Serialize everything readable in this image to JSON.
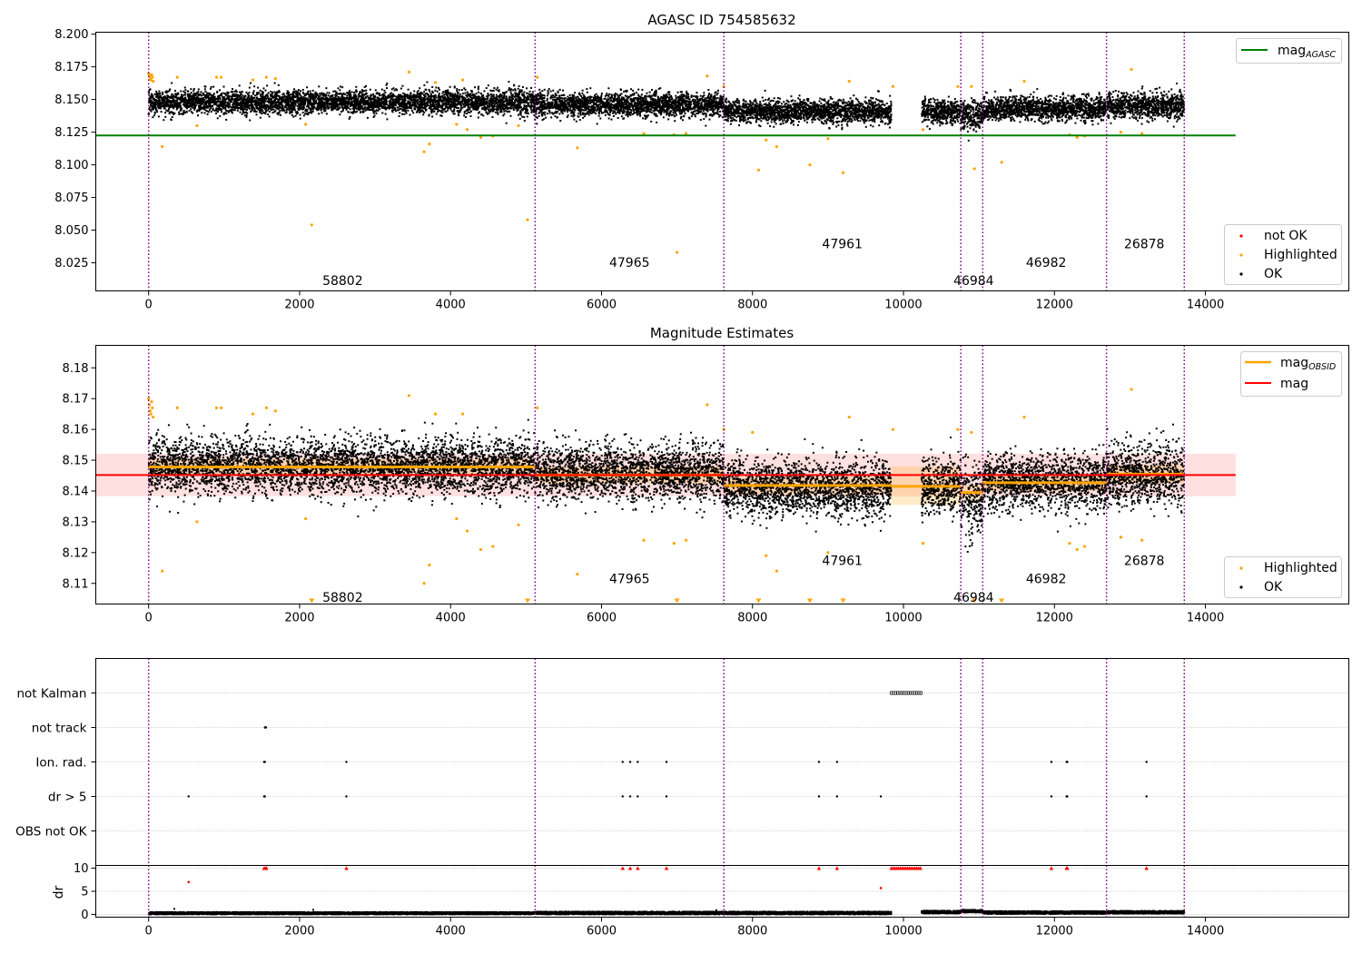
{
  "figure": {
    "background": "#ffffff"
  },
  "obsids": [
    "58802",
    "47965",
    "47961",
    "46984",
    "46982",
    "26878"
  ],
  "obsid_label_pos": [
    {
      "x": 2570,
      "panel1_y": 8.0115,
      "panel2_y": 8.1055
    },
    {
      "x": 6370,
      "panel1_y": 8.0255,
      "panel2_y": 8.1115
    },
    {
      "x": 9190,
      "panel1_y": 8.0395,
      "panel2_y": 8.1175
    },
    {
      "x": 10930,
      "panel1_y": 8.0115,
      "panel2_y": 8.1055
    },
    {
      "x": 11890,
      "panel1_y": 8.0255,
      "panel2_y": 8.1115
    },
    {
      "x": 13190,
      "panel1_y": 8.0395,
      "panel2_y": 8.1175
    }
  ],
  "boundaries": [
    0,
    5120,
    7620,
    10760,
    11050,
    12690,
    13720
  ],
  "gap": [
    9840,
    10240
  ],
  "colors": {
    "ok": "#000000",
    "highlighted": "#ffa500",
    "not_ok": "#ff0000",
    "agasc_line": "#008000",
    "mag_line": "#ff0000",
    "obsid_line": "#ffa500",
    "boundary": "#800080",
    "grid": "#b0b0b0"
  },
  "chart_data": [
    {
      "type": "scatter",
      "title": "AGASC ID 754585632",
      "xlim": [
        -700,
        15900
      ],
      "ylim": [
        8.0035,
        8.2015
      ],
      "xticks": [
        0,
        2000,
        4000,
        6000,
        8000,
        10000,
        12000,
        14000
      ],
      "yticks": [
        8.025,
        8.05,
        8.075,
        8.1,
        8.125,
        8.15,
        8.175,
        8.2
      ],
      "ytick_labels": [
        "8.025",
        "8.050",
        "8.075",
        "8.100",
        "8.125",
        "8.150",
        "8.175",
        "8.200"
      ],
      "mag_agasc": 8.1225,
      "mag_agasc_x_range": [
        -700,
        14400
      ],
      "line_legend": {
        "label": "mag",
        "subscript": "AGASC",
        "position": "top-right"
      },
      "point_legend": {
        "entries": [
          "not OK",
          "Highlighted",
          "OK"
        ],
        "position": "lower-right"
      },
      "ok_bands": [
        {
          "x": [
            0,
            5120
          ],
          "center": 8.148,
          "spread": 0.009
        },
        {
          "x": [
            5120,
            7620
          ],
          "center": 8.146,
          "spread": 0.009
        },
        {
          "x": [
            7620,
            9840
          ],
          "center": 8.141,
          "spread": 0.009
        },
        {
          "x": [
            10240,
            10760
          ],
          "center": 8.141,
          "spread": 0.009
        },
        {
          "x": [
            10760,
            11050
          ],
          "center": 8.138,
          "spread": 0.011
        },
        {
          "x": [
            11050,
            12690
          ],
          "center": 8.143,
          "spread": 0.009
        },
        {
          "x": [
            12690,
            13720
          ],
          "center": 8.145,
          "spread": 0.01
        }
      ],
      "highlighted_points": [
        [
          0,
          8.17
        ],
        [
          10,
          8.168
        ],
        [
          20,
          8.166
        ],
        [
          30,
          8.165
        ],
        [
          40,
          8.169
        ],
        [
          50,
          8.167
        ],
        [
          60,
          8.164
        ],
        [
          180,
          8.114
        ],
        [
          380,
          8.167
        ],
        [
          640,
          8.13
        ],
        [
          900,
          8.167
        ],
        [
          960,
          8.167
        ],
        [
          1380,
          8.165
        ],
        [
          1560,
          8.167
        ],
        [
          1680,
          8.166
        ],
        [
          2080,
          8.131
        ],
        [
          2160,
          8.054
        ],
        [
          3450,
          8.171
        ],
        [
          3650,
          8.11
        ],
        [
          3720,
          8.116
        ],
        [
          3800,
          8.163
        ],
        [
          4080,
          8.131
        ],
        [
          4160,
          8.165
        ],
        [
          4220,
          8.127
        ],
        [
          4400,
          8.121
        ],
        [
          4560,
          8.122
        ],
        [
          4900,
          8.13
        ],
        [
          5020,
          8.058
        ],
        [
          5150,
          8.167
        ],
        [
          5680,
          8.113
        ],
        [
          6560,
          8.124
        ],
        [
          6960,
          8.123
        ],
        [
          7000,
          8.033
        ],
        [
          7120,
          8.124
        ],
        [
          7400,
          8.168
        ],
        [
          7620,
          8.16
        ],
        [
          8080,
          8.096
        ],
        [
          8180,
          8.119
        ],
        [
          8320,
          8.114
        ],
        [
          8760,
          8.1
        ],
        [
          9000,
          8.12
        ],
        [
          9200,
          8.094
        ],
        [
          9280,
          8.164
        ],
        [
          9860,
          8.16
        ],
        [
          10260,
          8.127
        ],
        [
          10720,
          8.16
        ],
        [
          10900,
          8.16
        ],
        [
          10940,
          8.097
        ],
        [
          11300,
          8.102
        ],
        [
          11600,
          8.164
        ],
        [
          12200,
          8.123
        ],
        [
          12300,
          8.121
        ],
        [
          12400,
          8.122
        ],
        [
          12880,
          8.125
        ],
        [
          13020,
          8.173
        ],
        [
          13160,
          8.124
        ]
      ]
    },
    {
      "type": "scatter",
      "title": "Magnitude Estimates",
      "xlim": [
        -700,
        15900
      ],
      "ylim": [
        8.1033,
        8.1873
      ],
      "xticks": [
        0,
        2000,
        4000,
        6000,
        8000,
        10000,
        12000,
        14000
      ],
      "yticks": [
        8.11,
        8.12,
        8.13,
        8.14,
        8.15,
        8.16,
        8.17,
        8.18
      ],
      "ytick_labels": [
        "8.11",
        "8.12",
        "8.13",
        "8.14",
        "8.15",
        "8.16",
        "8.17",
        "8.18"
      ],
      "mag": 8.1452,
      "mag_band": [
        8.1383,
        8.1521
      ],
      "mag_x_range": [
        -700,
        14400
      ],
      "line_legend": {
        "entries": [
          {
            "label": "mag",
            "subscript": "OBSID"
          },
          {
            "label": "mag",
            "subscript": ""
          }
        ],
        "position": "top-right"
      },
      "point_legend": {
        "entries": [
          "Highlighted",
          "OK"
        ],
        "position": "lower-right"
      },
      "mag_obsid": [
        {
          "x": [
            0,
            5120
          ],
          "mag": 8.1478,
          "band": [
            8.145,
            8.1505
          ]
        },
        {
          "x": [
            5120,
            7620
          ],
          "mag": 8.1452,
          "band": [
            8.1425,
            8.148
          ]
        },
        {
          "x": [
            7620,
            9840
          ],
          "mag": 8.1418,
          "band": [
            8.139,
            8.1446
          ]
        },
        {
          "x": [
            9840,
            10760
          ],
          "mag": 8.1415,
          "band": [
            8.1355,
            8.148
          ]
        },
        {
          "x": [
            10760,
            11050
          ],
          "mag": 8.1395,
          "band": [
            8.137,
            8.142
          ]
        },
        {
          "x": [
            11050,
            12690
          ],
          "mag": 8.1427,
          "band": [
            8.14,
            8.1455
          ]
        },
        {
          "x": [
            12690,
            13720
          ],
          "mag": 8.1455,
          "band": [
            8.1425,
            8.1485
          ]
        }
      ],
      "ok_bands": [
        {
          "x": [
            0,
            5120
          ],
          "center": 8.148,
          "spread": 0.009
        },
        {
          "x": [
            5120,
            7620
          ],
          "center": 8.146,
          "spread": 0.009
        },
        {
          "x": [
            7620,
            9840
          ],
          "center": 8.141,
          "spread": 0.009
        },
        {
          "x": [
            10240,
            10760
          ],
          "center": 8.141,
          "spread": 0.009
        },
        {
          "x": [
            10760,
            11050
          ],
          "center": 8.138,
          "spread": 0.011
        },
        {
          "x": [
            11050,
            12690
          ],
          "center": 8.143,
          "spread": 0.009
        },
        {
          "x": [
            12690,
            13720
          ],
          "center": 8.145,
          "spread": 0.01
        }
      ],
      "highlighted_points": [
        [
          0,
          8.17
        ],
        [
          10,
          8.168
        ],
        [
          20,
          8.166
        ],
        [
          30,
          8.165
        ],
        [
          40,
          8.169
        ],
        [
          50,
          8.167
        ],
        [
          60,
          8.164
        ],
        [
          180,
          8.114
        ],
        [
          380,
          8.167
        ],
        [
          640,
          8.13
        ],
        [
          900,
          8.167
        ],
        [
          960,
          8.167
        ],
        [
          1380,
          8.165
        ],
        [
          1560,
          8.167
        ],
        [
          1680,
          8.166
        ],
        [
          2080,
          8.131
        ],
        [
          3450,
          8.171
        ],
        [
          3650,
          8.11
        ],
        [
          3720,
          8.116
        ],
        [
          3800,
          8.165
        ],
        [
          4080,
          8.131
        ],
        [
          4160,
          8.165
        ],
        [
          4220,
          8.127
        ],
        [
          4400,
          8.121
        ],
        [
          4560,
          8.122
        ],
        [
          4900,
          8.129
        ],
        [
          5150,
          8.167
        ],
        [
          5680,
          8.113
        ],
        [
          6560,
          8.124
        ],
        [
          6960,
          8.123
        ],
        [
          7120,
          8.124
        ],
        [
          7400,
          8.168
        ],
        [
          7620,
          8.16
        ],
        [
          8000,
          8.159
        ],
        [
          8180,
          8.119
        ],
        [
          8320,
          8.114
        ],
        [
          9000,
          8.12
        ],
        [
          9280,
          8.164
        ],
        [
          9860,
          8.16
        ],
        [
          10260,
          8.123
        ],
        [
          10720,
          8.16
        ],
        [
          10900,
          8.159
        ],
        [
          11600,
          8.164
        ],
        [
          12200,
          8.123
        ],
        [
          12300,
          8.121
        ],
        [
          12400,
          8.122
        ],
        [
          12880,
          8.125
        ],
        [
          13020,
          8.173
        ],
        [
          13160,
          8.124
        ]
      ],
      "offscale_low_x": [
        2160,
        5020,
        7000,
        8080,
        8760,
        9200,
        10940,
        11300
      ]
    },
    {
      "type": "scatter",
      "title": "",
      "xlim": [
        -700,
        15900
      ],
      "xticks": [
        0,
        2000,
        4000,
        6000,
        8000,
        10000,
        12000,
        14000
      ],
      "flag_rows": [
        "not Kalman",
        "not track",
        "Ion. rad.",
        "dr > 5",
        "OBS not OK"
      ],
      "flags": {
        "not Kalman": {
          "x_range": [
            9840,
            10240
          ]
        },
        "not track": {
          "x": [
            1540,
            1550,
            1555
          ]
        },
        "Ion. rad.": {
          "x": [
            1530,
            1540,
            2620,
            6280,
            6380,
            6480,
            6860,
            8880,
            9120,
            11960,
            12160,
            12170,
            13220
          ]
        },
        "dr > 5": {
          "x": [
            530,
            1530,
            1540,
            2620,
            6280,
            6380,
            6480,
            6860,
            8880,
            9120,
            9700,
            11960,
            12160,
            12170,
            13220
          ]
        },
        "OBS not OK": {
          "x": []
        }
      },
      "dr": {
        "ylabel": "dr",
        "ylim": [
          -0.6,
          10.6
        ],
        "yticks": [
          0,
          5,
          10
        ],
        "ytick_labels": [
          "0",
          "5",
          "10"
        ],
        "clip_value": 10,
        "base_bands": [
          {
            "x": [
              0,
              5120
            ],
            "center": 0.25,
            "spread": 0.25
          },
          {
            "x": [
              5120,
              7620
            ],
            "center": 0.3,
            "spread": 0.3
          },
          {
            "x": [
              7620,
              9840
            ],
            "center": 0.3,
            "spread": 0.3
          },
          {
            "x": [
              10240,
              10760
            ],
            "center": 0.5,
            "spread": 0.3
          },
          {
            "x": [
              10760,
              11050
            ],
            "center": 0.7,
            "spread": 0.3
          },
          {
            "x": [
              11050,
              12690
            ],
            "center": 0.4,
            "spread": 0.3
          },
          {
            "x": [
              12690,
              13720
            ],
            "center": 0.45,
            "spread": 0.3
          }
        ],
        "red_clipped_x": [
          1530,
          1545,
          1560,
          2620,
          6280,
          6380,
          6480,
          6860,
          8880,
          9120,
          11960,
          12160,
          12170,
          13220
        ],
        "red_clipped_range": [
          9840,
          10240
        ],
        "red_points": [
          [
            530,
            7.0
          ],
          [
            9700,
            5.7
          ]
        ],
        "black_outliers": [
          [
            340,
            1.2
          ],
          [
            2180,
            1.0
          ],
          [
            7520,
            0.9
          ]
        ]
      }
    }
  ]
}
